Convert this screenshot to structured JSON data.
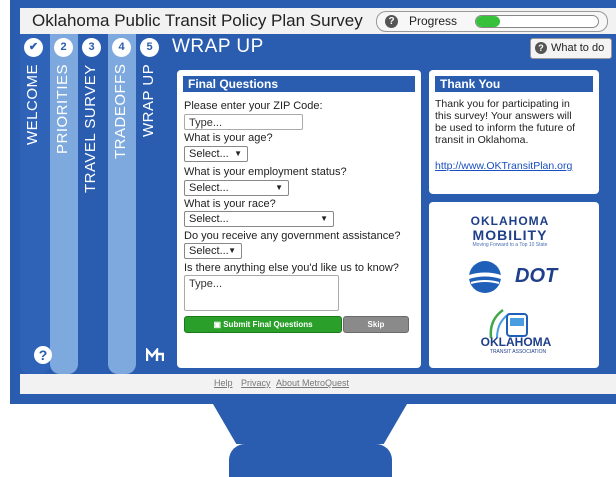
{
  "app": {
    "title": "Oklahoma Public Transit Policy Plan Survey"
  },
  "progress": {
    "label": "Progress",
    "value": 0.2
  },
  "tabs": [
    {
      "num": "✔",
      "label": "WELCOME"
    },
    {
      "num": "2",
      "label": "PRIORITIES"
    },
    {
      "num": "3",
      "label": "TRAVEL SURVEY"
    },
    {
      "num": "4",
      "label": "TRADEOFFS"
    },
    {
      "num": "5",
      "label": "WRAP UP"
    }
  ],
  "section": {
    "title": "WRAP UP",
    "what_to_do": "What to do"
  },
  "form": {
    "header": "Final Questions",
    "zip_label": "Please enter your ZIP Code:",
    "zip_placeholder": "Type...",
    "age_label": "What is your age?",
    "age_value": "Select...",
    "employment_label": "What is your employment status?",
    "employment_value": "Select...",
    "race_label": "What is your race?",
    "race_value": "Select...",
    "assistance_label": "Do you receive any government assistance?",
    "assistance_value": "Select...",
    "comments_label": "Is there anything else you'd like us to know?",
    "comments_placeholder": "Type...",
    "submit_label": "Submit Final Questions",
    "skip_label": "Skip"
  },
  "thankyou": {
    "header": "Thank You",
    "text": "Thank you for participating in this survey! Your answers will be used to inform the future of transit in Oklahoma.",
    "link": "http://www.OKTransitPlan.org"
  },
  "logos": {
    "mobility_line1": "OKLAHOMA",
    "mobility_line2": "MOBILITY",
    "mobility_tag": "Moving Forward to a Top 10 State",
    "odot": "DOT",
    "ota_name": "OKLAHOMA",
    "ota_sub": "TRANSIT ASSOCIATION"
  },
  "footer": {
    "help": "Help",
    "privacy": "Privacy",
    "about": "About MetroQuest"
  },
  "colors": {
    "brand_blue": "#2a5db0",
    "light_tab": "#7ea9de",
    "submit_green": "#2aa02a",
    "progress_green": "#35c23a"
  }
}
